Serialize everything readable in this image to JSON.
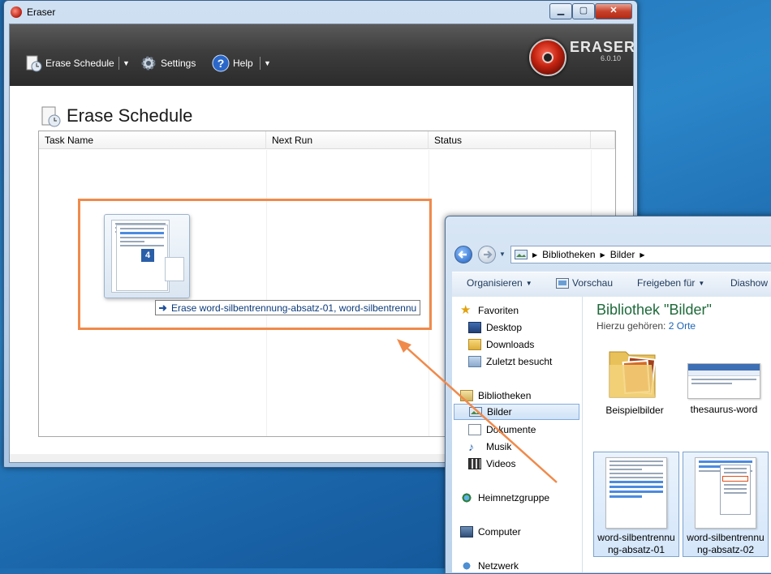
{
  "eraser": {
    "window_title": "Eraser",
    "toolbar": {
      "erase_schedule": "Erase Schedule",
      "settings": "Settings",
      "help": "Help"
    },
    "logo": {
      "name": "ERASER",
      "version": "6.0.10"
    },
    "section_title": "Erase Schedule",
    "columns": [
      "Task Name",
      "Next Run",
      "Status"
    ],
    "drag": {
      "badge_count": "4",
      "tooltip": "Erase word-silbentrennung-absatz-01, word-silbentrennu"
    }
  },
  "explorer": {
    "breadcrumb": [
      "Bibliotheken",
      "Bilder"
    ],
    "commands": [
      "Organisieren",
      "Vorschau",
      "Freigeben für",
      "Diashow"
    ],
    "nav": {
      "favorites": "Favoriten",
      "desktop": "Desktop",
      "downloads": "Downloads",
      "recent": "Zuletzt besucht",
      "libraries": "Bibliotheken",
      "pictures": "Bilder",
      "documents": "Dokumente",
      "music": "Musik",
      "videos": "Videos",
      "homegroup": "Heimnetzgruppe",
      "computer": "Computer",
      "network": "Netzwerk"
    },
    "library_title": "Bibliothek \"Bilder\"",
    "library_sub_label": "Hierzu gehören:",
    "library_sub_link": "2 Orte",
    "files": [
      {
        "label": "Beispielbilder"
      },
      {
        "label": "thesaurus-word"
      },
      {
        "label": "word-silbentrennung-absatz-01"
      },
      {
        "label": "word-silbentrennung-absatz-02"
      }
    ]
  },
  "colors": {
    "highlight": "#f08a4b",
    "desktop": "#2b86c9",
    "library_title": "#1e6a3a",
    "link": "#1c63b5"
  }
}
